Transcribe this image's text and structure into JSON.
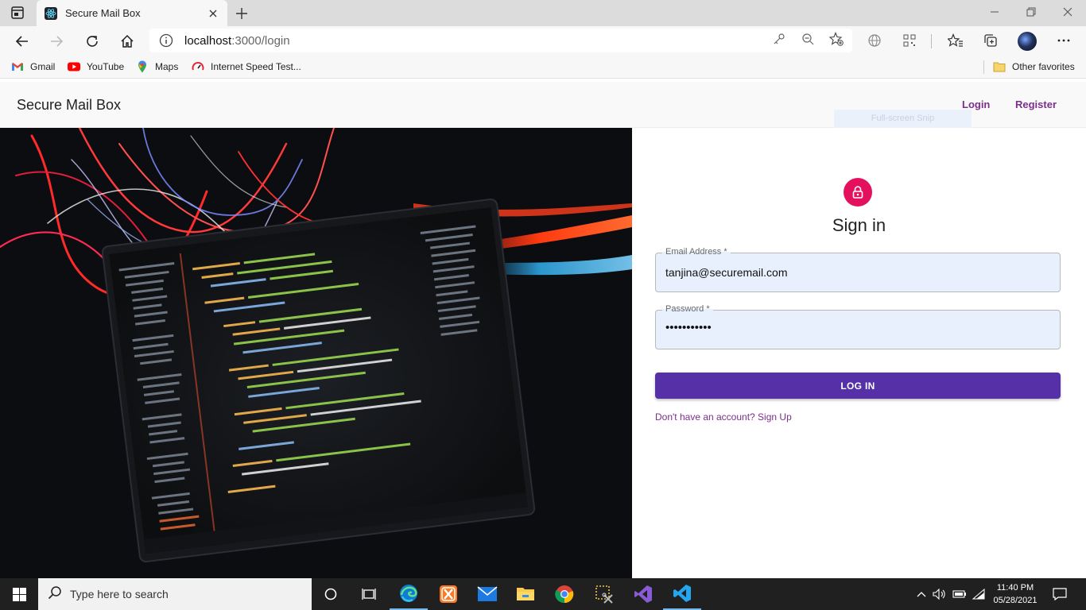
{
  "browser": {
    "tab_title": "Secure Mail Box",
    "url_host": "localhost",
    "url_rest": ":3000/login",
    "favorites": [
      {
        "label": "Gmail",
        "icon": "gmail-icon"
      },
      {
        "label": "YouTube",
        "icon": "youtube-icon"
      },
      {
        "label": "Maps",
        "icon": "maps-icon"
      },
      {
        "label": "Internet Speed Test...",
        "icon": "speedtest-icon"
      }
    ],
    "other_favorites": "Other favorites",
    "snip_overlay": "Full-screen Snip"
  },
  "app": {
    "brand": "Secure Mail Box",
    "nav_login": "Login",
    "nav_register": "Register"
  },
  "signin": {
    "title": "Sign in",
    "email_label": "Email Address *",
    "email_value": "tanjina@securemail.com",
    "password_label": "Password *",
    "password_value": "•••••••••••",
    "login_button": "LOG IN",
    "signup_link": "Don't have an account? Sign Up"
  },
  "taskbar": {
    "search_placeholder": "Type here to search",
    "time": "11:40 PM",
    "date": "05/28/2021"
  },
  "colors": {
    "accent_purple": "#5530a6",
    "link_purple": "#7b2e8e",
    "lock_pink": "#e5105d",
    "autofill_blue": "#e8f0fe"
  }
}
